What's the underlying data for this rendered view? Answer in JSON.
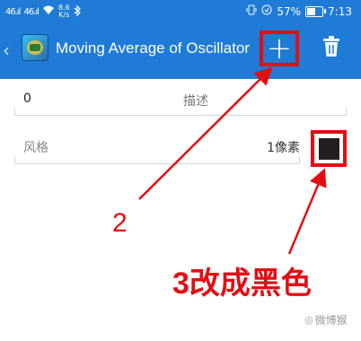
{
  "status_bar": {
    "signal_left": "46.ıl",
    "signal_right": "46.ıl",
    "net_speed_value": "8.6",
    "net_speed_unit": "K/s",
    "battery_percent": "57%",
    "time": "7:13"
  },
  "app_bar": {
    "title": "Moving Average of Oscillator"
  },
  "form": {
    "description_value": "0",
    "description_label": "描述",
    "style_label": "风格",
    "style_value": "1像素",
    "color_swatch": "#231f1f"
  },
  "annotations": {
    "label_2": "2",
    "label_3": "3改成黑色",
    "color": "#e30e14"
  },
  "watermark": {
    "text": "微博猴"
  }
}
